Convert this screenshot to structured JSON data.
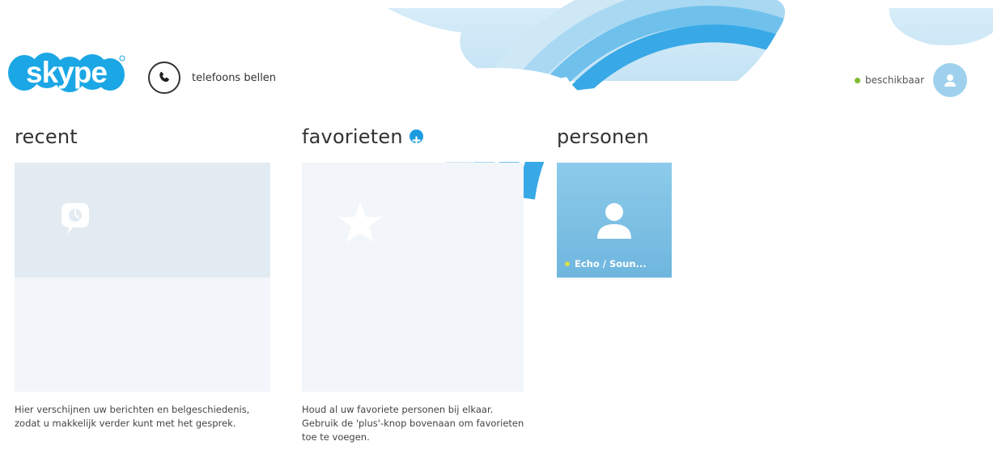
{
  "header": {
    "logo_text": "skype",
    "call_label": "telefoons bellen",
    "status_label": "beschikbaar"
  },
  "sections": {
    "recent": {
      "title": "recent",
      "description": "Hier verschijnen uw berichten en belgeschiedenis, zodat u makkelijk verder kunt met het gesprek."
    },
    "favorites": {
      "title": "favorieten",
      "description": "Houd al uw favoriete personen bij elkaar. Gebruik de 'plus'-knop bovenaan om favorieten toe te voegen."
    },
    "people": {
      "title": "personen",
      "contacts": [
        {
          "name": "Echo / Soun..."
        }
      ]
    }
  },
  "icons": {
    "call": "phone-icon",
    "status": "online-dot",
    "avatar": "user-icon",
    "add_favorite": "plus-icon",
    "recent_placeholder": "chat-clock-icon",
    "favorites_placeholder": "star-icon",
    "contact_avatar": "person-icon"
  },
  "colors": {
    "accent": "#1e9be0",
    "status_available": "#7fba2f",
    "contact_tile": "#7fc1e5",
    "placeholder_tile": "#e3ebf2"
  }
}
